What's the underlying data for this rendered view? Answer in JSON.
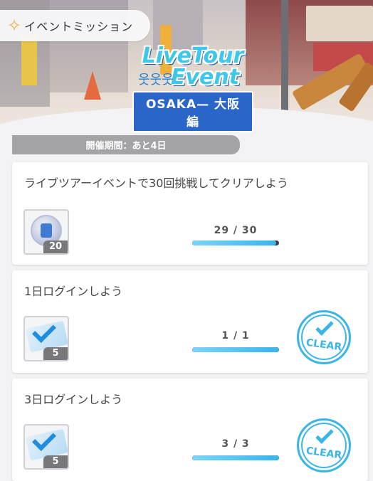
{
  "header": {
    "title": "イベントミッション",
    "logo": {
      "line1": "LiveTour",
      "line2": "Event",
      "subtitle": "OSAKA— 大阪編"
    }
  },
  "period": {
    "label": "開催期間：あと4日"
  },
  "missions": [
    {
      "title": "ライブツアーイベントで30回挑戦してクリアしよう",
      "reward_count": "20",
      "reward_icon": "medal-icon",
      "progress_text": "29 / 30",
      "progress_fraction": 0.967,
      "cleared": false
    },
    {
      "title": "1日ログインしよう",
      "reward_count": "5",
      "reward_icon": "ticket-icon",
      "progress_text": "1 / 1",
      "progress_fraction": 1.0,
      "cleared": true,
      "stamp_label": "CLEAR"
    },
    {
      "title": "3日ログインしよう",
      "reward_count": "5",
      "reward_icon": "ticket-icon",
      "progress_text": "3 / 3",
      "progress_fraction": 1.0,
      "cleared": true,
      "stamp_label": "CLEAR"
    }
  ],
  "colors": {
    "accent": "#3ab6e6",
    "progress_fill": "#38b4ec",
    "period_bar": "#a4a4a8"
  }
}
